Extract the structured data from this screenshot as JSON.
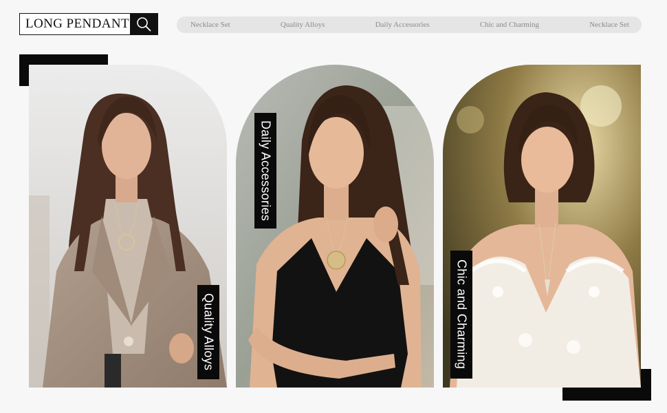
{
  "brand": {
    "title": "LONG PENDANT",
    "search_icon": "search-icon"
  },
  "nav": {
    "items": [
      {
        "label": "Necklace Set"
      },
      {
        "label": "Quality Alloys"
      },
      {
        "label": "Daily Accessories"
      },
      {
        "label": "Chic and Charming"
      },
      {
        "label": "Necklace Set"
      }
    ]
  },
  "cards": [
    {
      "label": "Quality Alloys"
    },
    {
      "label": "Daily Accessories"
    },
    {
      "label": "Chic and Charming"
    }
  ],
  "colors": {
    "background": "#f7f7f7",
    "accent": "#0a0a0a",
    "nav_pill": "#e5e5e5",
    "nav_text": "#8a8a8a"
  }
}
